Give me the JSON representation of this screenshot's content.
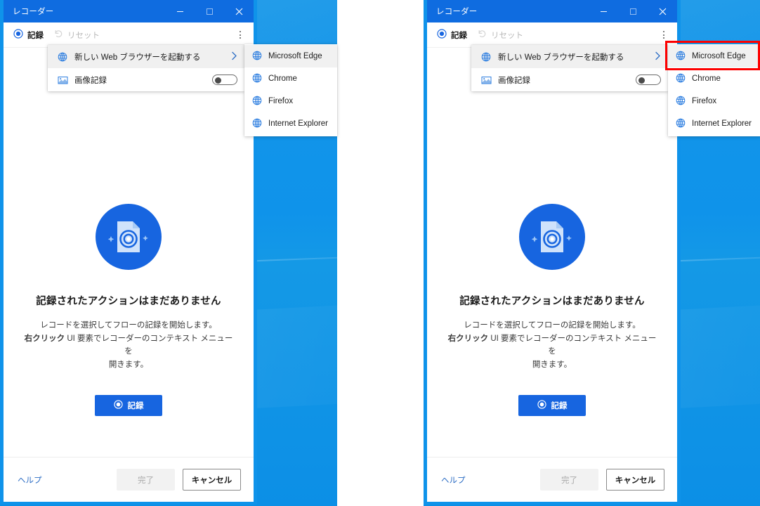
{
  "window": {
    "title": "レコーダー",
    "buttons": {
      "minimize": "minimize-button",
      "maximize": "maximize-button",
      "close": "close-button"
    }
  },
  "toolbar": {
    "record_label": "記録",
    "reset_label": "リセット",
    "overflow_label": "more-options"
  },
  "menu": {
    "items": [
      {
        "label": "新しい Web ブラウザーを起動する",
        "icon": "globe-icon",
        "has_submenu": true,
        "highlighted": true
      },
      {
        "label": "画像記録",
        "icon": "image-icon",
        "toggle": "off"
      }
    ]
  },
  "submenu": {
    "items": [
      {
        "label": "Microsoft Edge",
        "icon": "globe-icon",
        "highlighted": true
      },
      {
        "label": "Chrome",
        "icon": "globe-icon",
        "highlighted": false
      },
      {
        "label": "Firefox",
        "icon": "globe-icon",
        "highlighted": false
      },
      {
        "label": "Internet Explorer",
        "icon": "globe-icon",
        "highlighted": false
      }
    ]
  },
  "empty_state": {
    "icon": "record-document-icon",
    "title": "記録されたアクションはまだありません",
    "desc_line1": "レコードを選択してフローの記録を開始します。",
    "desc_bold": "右クリック",
    "desc_line2": " UI 要素でレコーダーのコンテキスト メニューを",
    "desc_line3": "開きます。",
    "record_button": "記録"
  },
  "footer": {
    "help": "ヘルプ",
    "done": "完了",
    "cancel": "キャンセル"
  },
  "annotation": {
    "color": "#fd0000",
    "target": "Microsoft Edge"
  },
  "colors": {
    "title_bar": "#0f6ce0",
    "accent": "#1765e0",
    "window_border": "#0f93ea",
    "wallpaper": "#0f93ea",
    "link": "#2b6cc4",
    "highlight_red": "#fd0000"
  }
}
